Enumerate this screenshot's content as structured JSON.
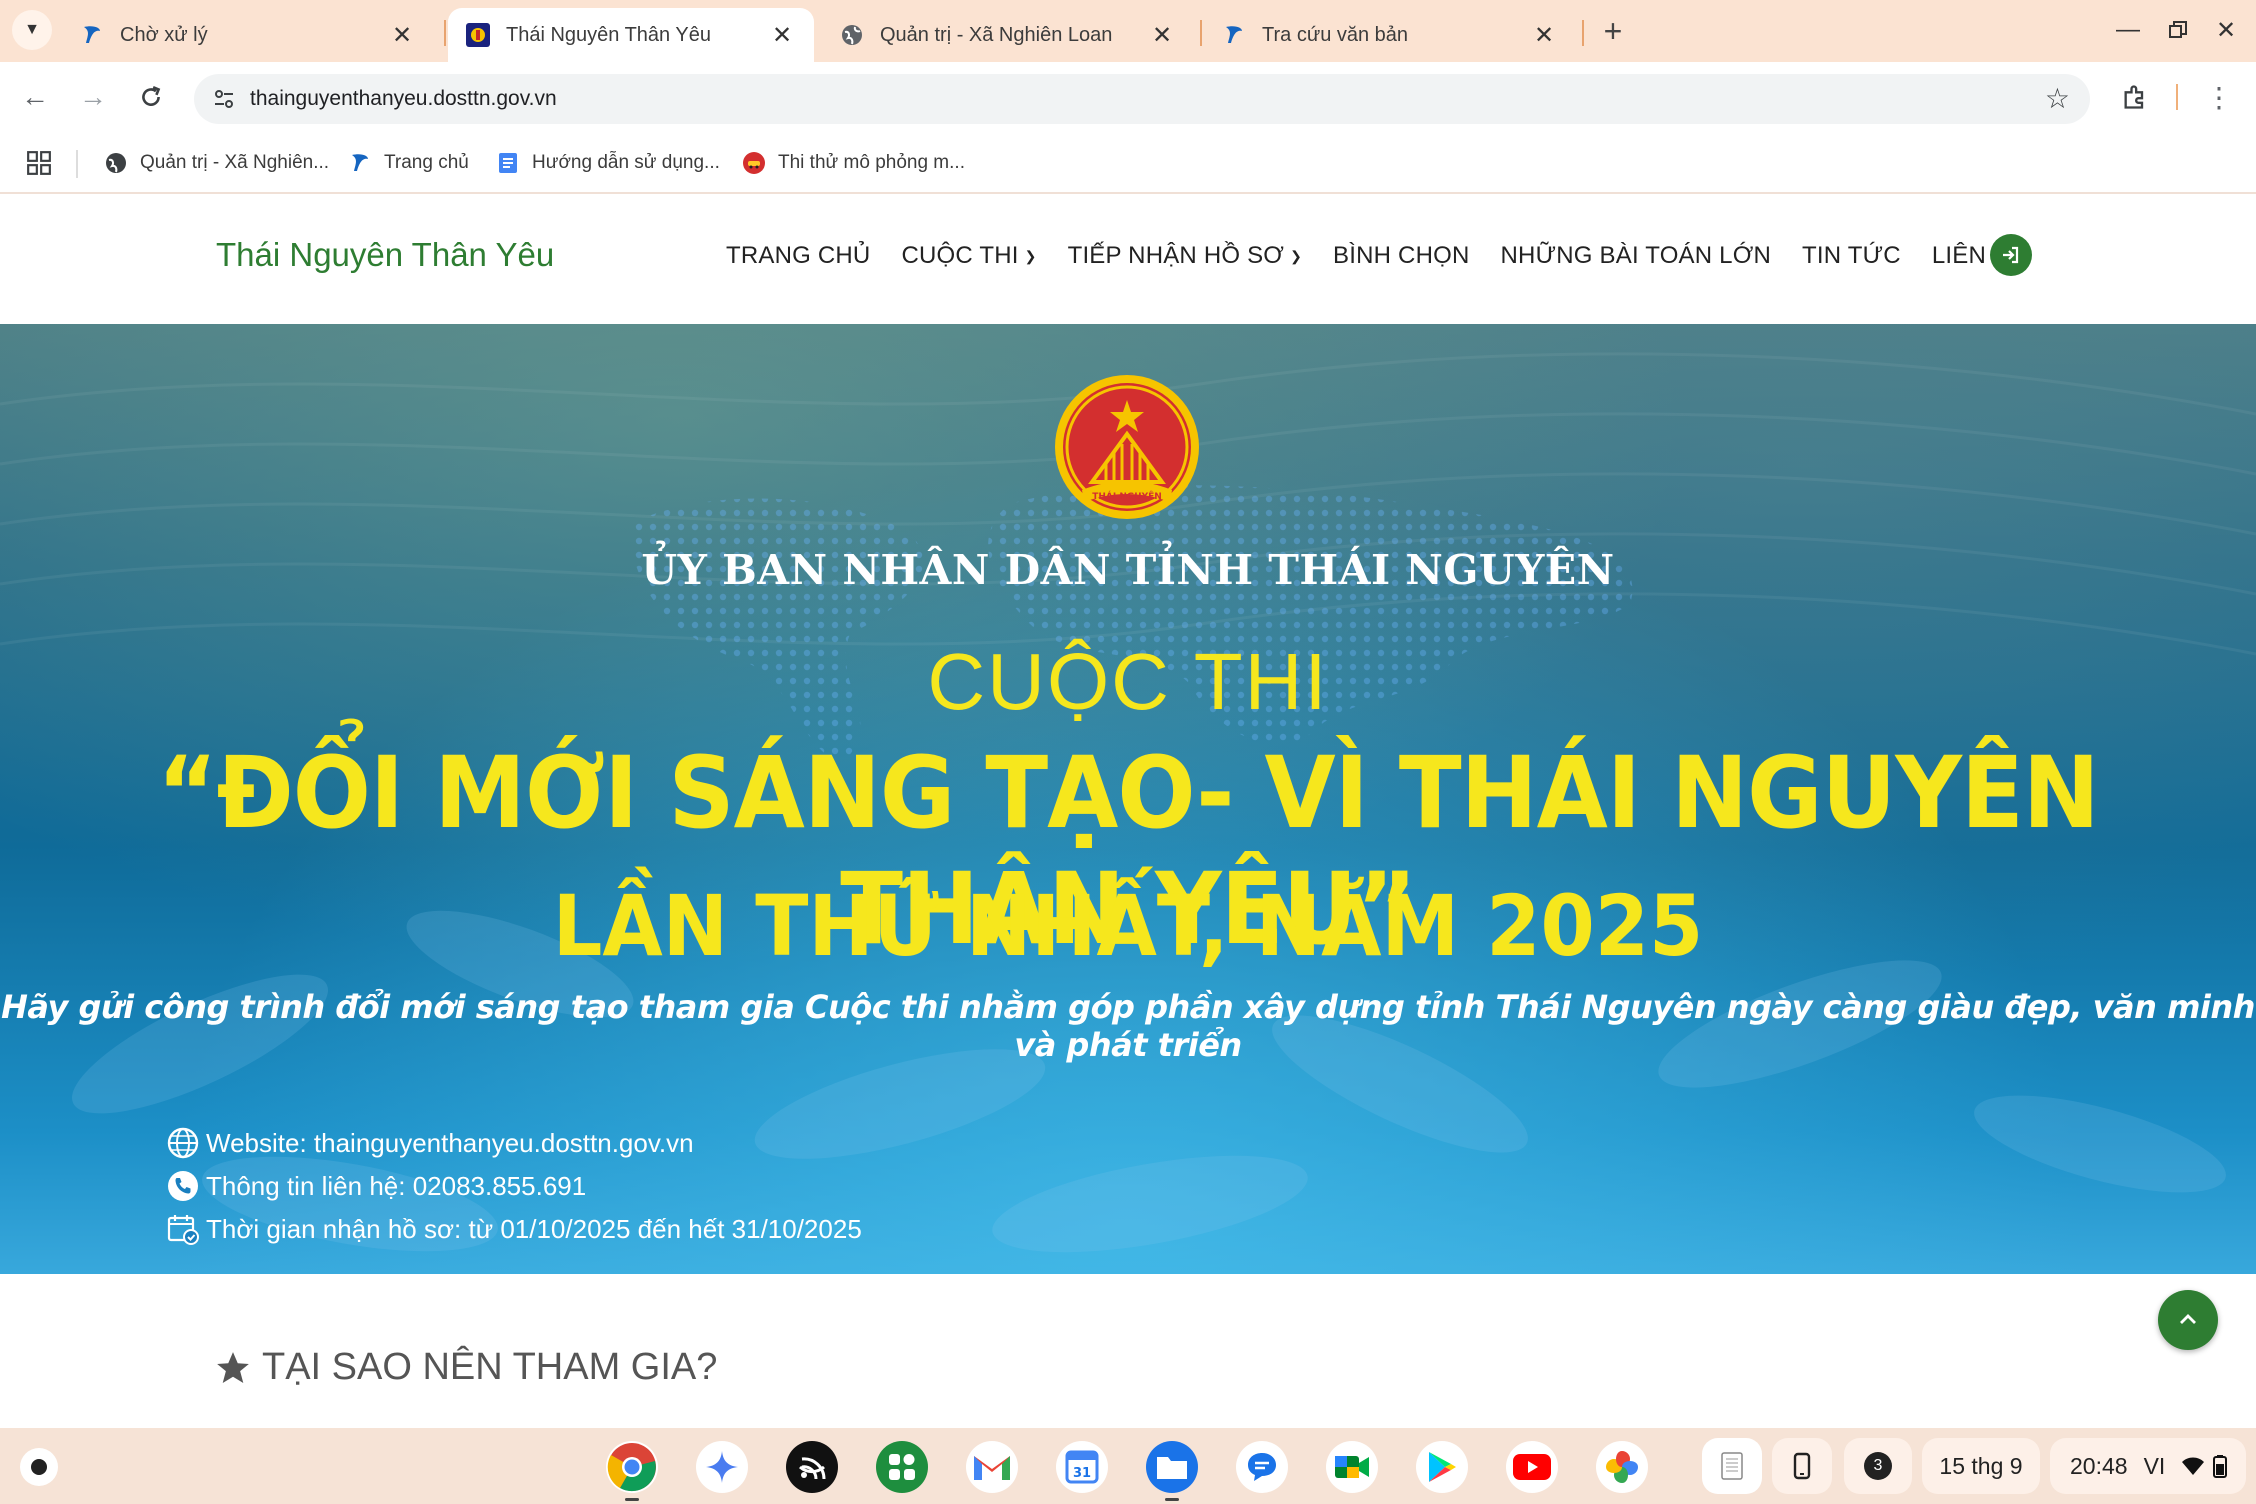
{
  "browser": {
    "tabs": [
      {
        "title": "Chờ xử lý",
        "active": false
      },
      {
        "title": "Thái Nguyên Thân Yêu",
        "active": true
      },
      {
        "title": "Quản trị - Xã Nghiên Loan",
        "active": false
      },
      {
        "title": "Tra cứu văn bản",
        "active": false
      }
    ],
    "url": "thainguyenthanyeu.dosttn.gov.vn",
    "bookmarks": [
      {
        "label": "Quản trị - Xã Nghiên..."
      },
      {
        "label": "Trang chủ"
      },
      {
        "label": "Hướng dẫn sử dụng..."
      },
      {
        "label": "Thi thử mô phỏng m..."
      }
    ]
  },
  "site": {
    "logo": "Thái Nguyên Thân Yêu",
    "menu": [
      {
        "label": "TRANG CHỦ",
        "dropdown": false
      },
      {
        "label": "CUỘC THI",
        "dropdown": true
      },
      {
        "label": "TIẾP NHẬN HỒ SƠ",
        "dropdown": true
      },
      {
        "label": "BÌNH CHỌN",
        "dropdown": false
      },
      {
        "label": "NHỮNG BÀI TOÁN LỚN",
        "dropdown": false
      },
      {
        "label": "TIN TỨC",
        "dropdown": false
      },
      {
        "label": "LIÊN HỆ",
        "dropdown": false
      }
    ],
    "accent_color": "#2e7d32"
  },
  "hero": {
    "emblem_text": "THÁI NGUYÊN",
    "org": "ỦY BAN NHÂN DÂN TỈNH THÁI NGUYÊN",
    "heading": "CUỘC THI",
    "title": "“ĐỔI MỚI SÁNG TẠO- VÌ THÁI NGUYÊN THÂN YÊU”",
    "subtitle": "LẦN THỨ NHẤT, NĂM 2025",
    "tagline": "Hãy gửi công trình đổi mới sáng tạo tham gia Cuộc thi nhằm góp phần xây dựng tỉnh Thái Nguyên ngày càng giàu đẹp, văn minh và phát triển",
    "info": {
      "website": "Website: thainguyenthanyeu.dosttn.gov.vn",
      "contact": "Thông tin liên hệ: 02083.855.691",
      "period": "Thời gian nhận hồ sơ: từ 01/10/2025 đến hết 31/10/2025"
    },
    "title_color": "#f6e71d"
  },
  "section": {
    "title": "TẠI SAO NÊN THAM GIA?"
  },
  "shelf": {
    "notification_count": "3",
    "date": "15 thg 9",
    "time": "20:48",
    "ime": "VI",
    "calendar_day": "31"
  }
}
